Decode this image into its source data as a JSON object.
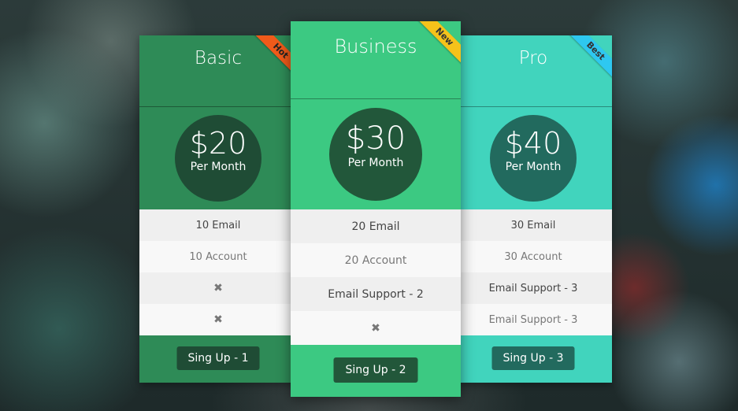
{
  "plans": {
    "basic": {
      "title": "Basic",
      "ribbon": "Hot",
      "price": "$20",
      "period": "Per Month",
      "features": [
        "10 Email",
        "10 Account",
        "✖",
        "✖"
      ],
      "button": "Sing Up - 1",
      "color": "#2e8b57"
    },
    "business": {
      "title": "Business",
      "ribbon": "New",
      "price": "$30",
      "period": "Per Month",
      "features": [
        "20 Email",
        "20 Account",
        "Email Support - 2",
        "✖"
      ],
      "button": "Sing Up - 2",
      "color": "#3cc982"
    },
    "pro": {
      "title": "Pro",
      "ribbon": "Best",
      "price": "$40",
      "period": "Per Month",
      "features": [
        "30 Email",
        "30 Account",
        "Email Support - 3",
        "Email Support - 3"
      ],
      "button": "Sing Up - 3",
      "color": "#41d4bd"
    }
  },
  "colors": {
    "hot_ribbon": "#f05a1a",
    "new_ribbon": "#f6c21a",
    "best_ribbon": "#2ec8f0"
  }
}
